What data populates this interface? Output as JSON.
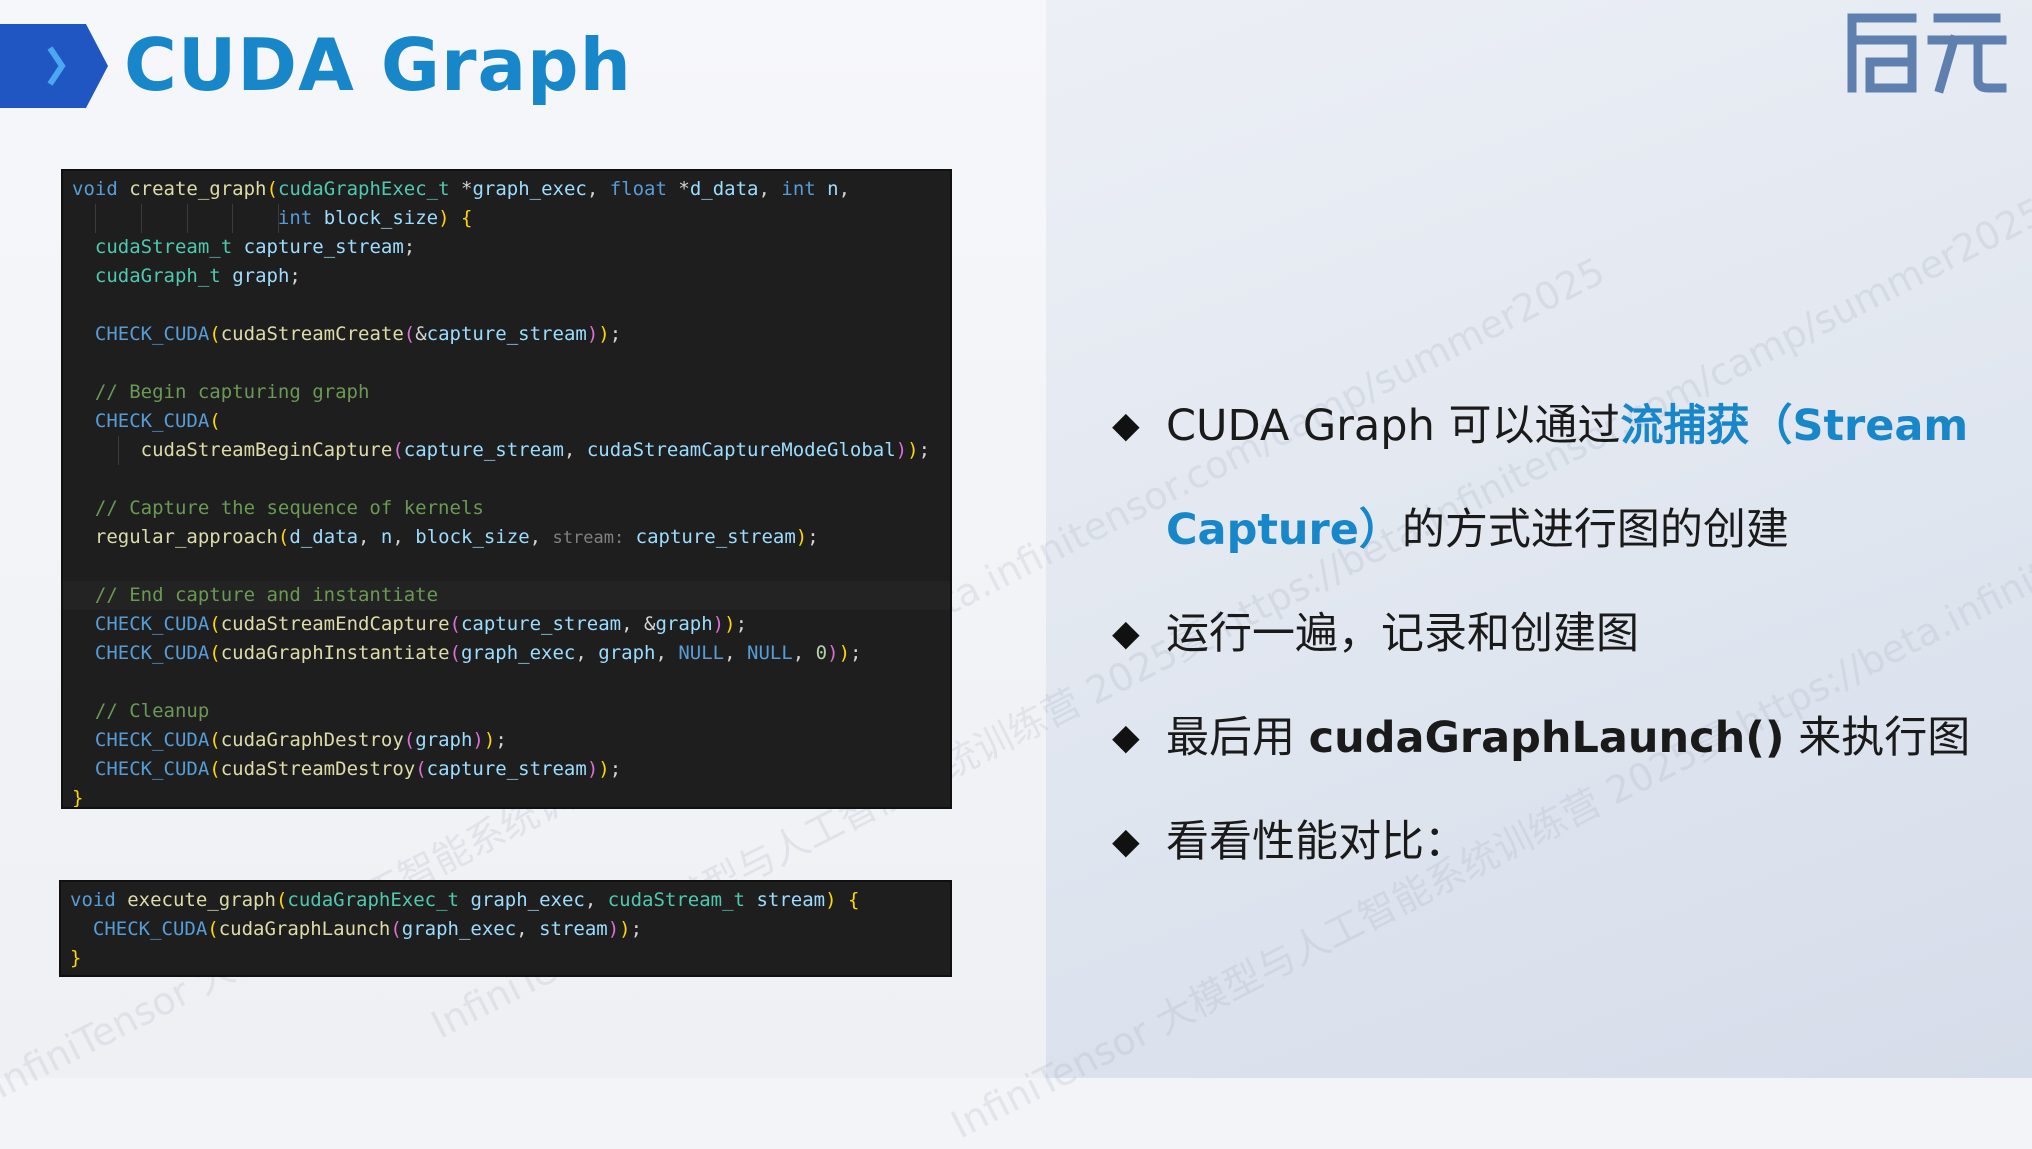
{
  "slide": {
    "title": "CUDA Graph",
    "logo_text": "启元",
    "colors": {
      "accent": "#1887c9",
      "chevron": "#1f56c2",
      "code_bg": "#1e1e1e"
    }
  },
  "code_blocks": [
    {
      "lines": [
        [
          [
            "kw",
            "void"
          ],
          [
            "p",
            " "
          ],
          [
            "fn",
            "create_graph"
          ],
          [
            "b",
            "("
          ],
          [
            "ty",
            "cudaGraphExec_t"
          ],
          [
            "p",
            " "
          ],
          [
            "op",
            "*"
          ],
          [
            "v",
            "graph_exec"
          ],
          [
            "p",
            ", "
          ],
          [
            "kw",
            "float"
          ],
          [
            "p",
            " "
          ],
          [
            "op",
            "*"
          ],
          [
            "v",
            "d_data"
          ],
          [
            "p",
            ", "
          ],
          [
            "kw",
            "int"
          ],
          [
            "p",
            " "
          ],
          [
            "v",
            "n"
          ],
          [
            "p",
            ","
          ]
        ],
        [
          [
            "p",
            "                  "
          ],
          [
            "kw",
            "int"
          ],
          [
            "p",
            " "
          ],
          [
            "v",
            "block_size"
          ],
          [
            "b",
            ")"
          ],
          [
            "p",
            " "
          ],
          [
            "b",
            "{"
          ]
        ],
        [
          [
            "p",
            "  "
          ],
          [
            "ty",
            "cudaStream_t"
          ],
          [
            "p",
            " "
          ],
          [
            "v",
            "capture_stream"
          ],
          [
            "p",
            ";"
          ]
        ],
        [
          [
            "p",
            "  "
          ],
          [
            "ty",
            "cudaGraph_t"
          ],
          [
            "p",
            " "
          ],
          [
            "v",
            "graph"
          ],
          [
            "p",
            ";"
          ]
        ],
        [],
        [
          [
            "p",
            "  "
          ],
          [
            "mac",
            "CHECK_CUDA"
          ],
          [
            "b",
            "("
          ],
          [
            "fn",
            "cudaStreamCreate"
          ],
          [
            "b2",
            "("
          ],
          [
            "p",
            "&"
          ],
          [
            "v",
            "capture_stream"
          ],
          [
            "b2",
            ")"
          ],
          [
            "b",
            ")"
          ],
          [
            "p",
            ";"
          ]
        ],
        [],
        [
          [
            "p",
            "  "
          ],
          [
            "cm",
            "// Begin capturing graph"
          ]
        ],
        [
          [
            "p",
            "  "
          ],
          [
            "mac",
            "CHECK_CUDA"
          ],
          [
            "b",
            "("
          ]
        ],
        [
          [
            "p",
            "      "
          ],
          [
            "fn",
            "cudaStreamBeginCapture"
          ],
          [
            "b2",
            "("
          ],
          [
            "v",
            "capture_stream"
          ],
          [
            "p",
            ", "
          ],
          [
            "v",
            "cudaStreamCaptureModeGlobal"
          ],
          [
            "b2",
            ")"
          ],
          [
            "b",
            ")"
          ],
          [
            "p",
            ";"
          ]
        ],
        [],
        [
          [
            "p",
            "  "
          ],
          [
            "cm",
            "// Capture the sequence of kernels"
          ]
        ],
        [
          [
            "p",
            "  "
          ],
          [
            "fn",
            "regular_approach"
          ],
          [
            "b",
            "("
          ],
          [
            "v",
            "d_data"
          ],
          [
            "p",
            ", "
          ],
          [
            "v",
            "n"
          ],
          [
            "p",
            ", "
          ],
          [
            "v",
            "block_size"
          ],
          [
            "p",
            ", "
          ],
          [
            "hint",
            "stream:"
          ],
          [
            "p",
            " "
          ],
          [
            "v",
            "capture_stream"
          ],
          [
            "b",
            ")"
          ],
          [
            "p",
            ";"
          ]
        ],
        [],
        [
          [
            "p",
            "  "
          ],
          [
            "cm",
            "// End capture and instantiate"
          ]
        ],
        [
          [
            "p",
            "  "
          ],
          [
            "mac",
            "CHECK_CUDA"
          ],
          [
            "b",
            "("
          ],
          [
            "fn",
            "cudaStreamEndCapture"
          ],
          [
            "b2",
            "("
          ],
          [
            "v",
            "capture_stream"
          ],
          [
            "p",
            ", &"
          ],
          [
            "v",
            "graph"
          ],
          [
            "b2",
            ")"
          ],
          [
            "b",
            ")"
          ],
          [
            "p",
            ";"
          ]
        ],
        [
          [
            "p",
            "  "
          ],
          [
            "mac",
            "CHECK_CUDA"
          ],
          [
            "b",
            "("
          ],
          [
            "fn",
            "cudaGraphInstantiate"
          ],
          [
            "b2",
            "("
          ],
          [
            "v",
            "graph_exec"
          ],
          [
            "p",
            ", "
          ],
          [
            "v",
            "graph"
          ],
          [
            "p",
            ", "
          ],
          [
            "const",
            "NULL"
          ],
          [
            "p",
            ", "
          ],
          [
            "const",
            "NULL"
          ],
          [
            "p",
            ", "
          ],
          [
            "num",
            "0"
          ],
          [
            "b2",
            ")"
          ],
          [
            "b",
            ")"
          ],
          [
            "p",
            ";"
          ]
        ],
        [],
        [
          [
            "p",
            "  "
          ],
          [
            "cm",
            "// Cleanup"
          ]
        ],
        [
          [
            "p",
            "  "
          ],
          [
            "mac",
            "CHECK_CUDA"
          ],
          [
            "b",
            "("
          ],
          [
            "fn",
            "cudaGraphDestroy"
          ],
          [
            "b2",
            "("
          ],
          [
            "v",
            "graph"
          ],
          [
            "b2",
            ")"
          ],
          [
            "b",
            ")"
          ],
          [
            "p",
            ";"
          ]
        ],
        [
          [
            "p",
            "  "
          ],
          [
            "mac",
            "CHECK_CUDA"
          ],
          [
            "b",
            "("
          ],
          [
            "fn",
            "cudaStreamDestroy"
          ],
          [
            "b2",
            "("
          ],
          [
            "v",
            "capture_stream"
          ],
          [
            "b2",
            ")"
          ],
          [
            "b",
            ")"
          ],
          [
            "p",
            ";"
          ]
        ],
        [
          [
            "b",
            "}"
          ]
        ]
      ]
    },
    {
      "lines": [
        [
          [
            "kw",
            "void"
          ],
          [
            "p",
            " "
          ],
          [
            "fn",
            "execute_graph"
          ],
          [
            "b",
            "("
          ],
          [
            "ty",
            "cudaGraphExec_t"
          ],
          [
            "p",
            " "
          ],
          [
            "v",
            "graph_exec"
          ],
          [
            "p",
            ", "
          ],
          [
            "ty",
            "cudaStream_t"
          ],
          [
            "p",
            " "
          ],
          [
            "v",
            "stream"
          ],
          [
            "b",
            ")"
          ],
          [
            "p",
            " "
          ],
          [
            "b",
            "{"
          ]
        ],
        [
          [
            "p",
            "  "
          ],
          [
            "mac",
            "CHECK_CUDA"
          ],
          [
            "b",
            "("
          ],
          [
            "fn",
            "cudaGraphLaunch"
          ],
          [
            "b2",
            "("
          ],
          [
            "v",
            "graph_exec"
          ],
          [
            "p",
            ", "
          ],
          [
            "v",
            "stream"
          ],
          [
            "b2",
            ")"
          ],
          [
            "b",
            ")"
          ],
          [
            "p",
            ";"
          ]
        ],
        [
          [
            "b",
            "}"
          ]
        ]
      ]
    }
  ],
  "bullets": [
    {
      "segments": [
        [
          "n",
          "CUDA Graph 可以通过"
        ],
        [
          "a",
          "流捕获（Stream"
        ]
      ]
    },
    {
      "segments": [
        [
          "a",
          "Capture）"
        ],
        [
          "n",
          "的方式进行图的创建"
        ]
      ],
      "continuation": true
    },
    {
      "segments": [
        [
          "n",
          "运行一遍，记录和创建图"
        ]
      ]
    },
    {
      "segments": [
        [
          "n",
          "最后用 "
        ],
        [
          "s",
          "cudaGraphLaunch()"
        ],
        [
          "n",
          " 来执行图"
        ]
      ]
    },
    {
      "segments": [
        [
          "n",
          "看看性能对比："
        ]
      ]
    }
  ],
  "bullet_marker": "◆",
  "watermarks": [
    "InfiniTensor 大模型与人工智能系统训练营 2025夏 https://beta.infinitensor.com/camp/summer2025",
    "InfiniTensor 大模型与人工智能系统训练营 2025夏 https://beta.infinitensor.com/camp/summer2025",
    "InfiniTensor 大模型与人工智能系统训练营 2025夏 https://beta.infinitensor.com/camp/summer2025"
  ]
}
